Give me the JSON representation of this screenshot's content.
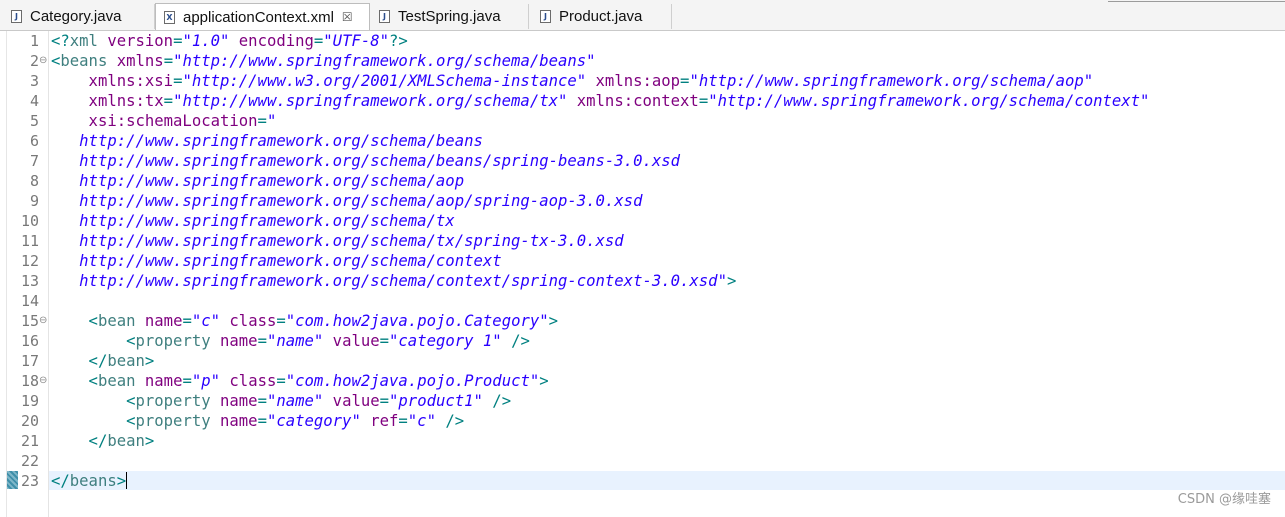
{
  "tabs": [
    {
      "label": "Category.java",
      "icon": "java-file-icon",
      "active": false
    },
    {
      "label": "applicationContext.xml",
      "icon": "xml-file-icon",
      "active": true
    },
    {
      "label": "TestSpring.java",
      "icon": "java-file-icon",
      "active": false
    },
    {
      "label": "Product.java",
      "icon": "java-file-icon",
      "active": false
    }
  ],
  "tab_close_glyph": "☒",
  "editor": {
    "current_line": 23,
    "lines": [
      {
        "n": "1",
        "fold": "",
        "tokens": [
          [
            "b",
            "<?"
          ],
          [
            "t",
            "xml"
          ],
          [
            "a",
            " version"
          ],
          [
            "b",
            "="
          ],
          [
            "v",
            "\"1.0\""
          ],
          [
            "a",
            " encoding"
          ],
          [
            "b",
            "="
          ],
          [
            "v",
            "\"UTF-8\""
          ],
          [
            "b",
            "?>"
          ]
        ]
      },
      {
        "n": "2",
        "fold": "⊖",
        "tokens": [
          [
            "b",
            "<"
          ],
          [
            "t",
            "beans"
          ],
          [
            "a",
            " xmlns"
          ],
          [
            "b",
            "="
          ],
          [
            "v",
            "\"http://www.springframework.org/schema/beans\""
          ]
        ]
      },
      {
        "n": "3",
        "fold": "",
        "tokens": [
          [
            "a",
            "    xmlns:xsi"
          ],
          [
            "b",
            "="
          ],
          [
            "v",
            "\"http://www.w3.org/2001/XMLSchema-instance\""
          ],
          [
            "a",
            " xmlns:aop"
          ],
          [
            "b",
            "="
          ],
          [
            "v",
            "\"http://www.springframework.org/schema/aop\""
          ]
        ]
      },
      {
        "n": "4",
        "fold": "",
        "tokens": [
          [
            "a",
            "    xmlns:tx"
          ],
          [
            "b",
            "="
          ],
          [
            "v",
            "\"http://www.springframework.org/schema/tx\""
          ],
          [
            "a",
            " xmlns:context"
          ],
          [
            "b",
            "="
          ],
          [
            "v",
            "\"http://www.springframework.org/schema/context\""
          ]
        ]
      },
      {
        "n": "5",
        "fold": "",
        "tokens": [
          [
            "a",
            "    xsi:schemaLocation"
          ],
          [
            "b",
            "="
          ],
          [
            "v",
            "\""
          ]
        ]
      },
      {
        "n": "6",
        "fold": "",
        "tokens": [
          [
            "v",
            "   http://www.springframework.org/schema/beans"
          ]
        ]
      },
      {
        "n": "7",
        "fold": "",
        "tokens": [
          [
            "v",
            "   http://www.springframework.org/schema/beans/spring-beans-3.0.xsd"
          ]
        ]
      },
      {
        "n": "8",
        "fold": "",
        "tokens": [
          [
            "v",
            "   http://www.springframework.org/schema/aop"
          ]
        ]
      },
      {
        "n": "9",
        "fold": "",
        "tokens": [
          [
            "v",
            "   http://www.springframework.org/schema/aop/spring-aop-3.0.xsd"
          ]
        ]
      },
      {
        "n": "10",
        "fold": "",
        "tokens": [
          [
            "v",
            "   http://www.springframework.org/schema/tx"
          ]
        ]
      },
      {
        "n": "11",
        "fold": "",
        "tokens": [
          [
            "v",
            "   http://www.springframework.org/schema/tx/spring-tx-3.0.xsd"
          ]
        ]
      },
      {
        "n": "12",
        "fold": "",
        "tokens": [
          [
            "v",
            "   http://www.springframework.org/schema/context"
          ]
        ]
      },
      {
        "n": "13",
        "fold": "",
        "tokens": [
          [
            "v",
            "   http://www.springframework.org/schema/context/spring-context-3.0.xsd\""
          ],
          [
            "b",
            ">"
          ]
        ]
      },
      {
        "n": "14",
        "fold": "",
        "tokens": []
      },
      {
        "n": "15",
        "fold": "⊖",
        "tokens": [
          [
            "b",
            "    <"
          ],
          [
            "t",
            "bean"
          ],
          [
            "a",
            " name"
          ],
          [
            "b",
            "="
          ],
          [
            "v",
            "\"c\""
          ],
          [
            "a",
            " class"
          ],
          [
            "b",
            "="
          ],
          [
            "v",
            "\"com.how2java.pojo.Category\""
          ],
          [
            "b",
            ">"
          ]
        ]
      },
      {
        "n": "16",
        "fold": "",
        "tokens": [
          [
            "b",
            "        <"
          ],
          [
            "t",
            "property"
          ],
          [
            "a",
            " name"
          ],
          [
            "b",
            "="
          ],
          [
            "v",
            "\"name\""
          ],
          [
            "a",
            " value"
          ],
          [
            "b",
            "="
          ],
          [
            "v",
            "\"category 1\""
          ],
          [
            "b",
            " />"
          ]
        ]
      },
      {
        "n": "17",
        "fold": "",
        "tokens": [
          [
            "b",
            "    </"
          ],
          [
            "t",
            "bean"
          ],
          [
            "b",
            ">"
          ]
        ]
      },
      {
        "n": "18",
        "fold": "⊖",
        "tokens": [
          [
            "b",
            "    <"
          ],
          [
            "t",
            "bean"
          ],
          [
            "a",
            " name"
          ],
          [
            "b",
            "="
          ],
          [
            "v",
            "\"p\""
          ],
          [
            "a",
            " class"
          ],
          [
            "b",
            "="
          ],
          [
            "v",
            "\"com.how2java.pojo.Product\""
          ],
          [
            "b",
            ">"
          ]
        ]
      },
      {
        "n": "19",
        "fold": "",
        "tokens": [
          [
            "b",
            "        <"
          ],
          [
            "t",
            "property"
          ],
          [
            "a",
            " name"
          ],
          [
            "b",
            "="
          ],
          [
            "v",
            "\"name\""
          ],
          [
            "a",
            " value"
          ],
          [
            "b",
            "="
          ],
          [
            "v",
            "\"product1\""
          ],
          [
            "b",
            " />"
          ]
        ]
      },
      {
        "n": "20",
        "fold": "",
        "tokens": [
          [
            "b",
            "        <"
          ],
          [
            "t",
            "property"
          ],
          [
            "a",
            " name"
          ],
          [
            "b",
            "="
          ],
          [
            "v",
            "\"category\""
          ],
          [
            "a",
            " ref"
          ],
          [
            "b",
            "="
          ],
          [
            "v",
            "\"c\""
          ],
          [
            "b",
            " />"
          ]
        ]
      },
      {
        "n": "21",
        "fold": "",
        "tokens": [
          [
            "b",
            "    </"
          ],
          [
            "t",
            "bean"
          ],
          [
            "b",
            ">"
          ]
        ]
      },
      {
        "n": "22",
        "fold": "",
        "tokens": []
      },
      {
        "n": "23",
        "fold": "",
        "tokens": [
          [
            "b",
            "</"
          ],
          [
            "t",
            "beans"
          ],
          [
            "b",
            ">"
          ]
        ]
      }
    ]
  },
  "watermark": "CSDN @缘哇塞",
  "colors": {
    "bracket": "#008080",
    "tag": "#3f7f7f",
    "attribute": "#7f007f",
    "value": "#2a00ff",
    "current_line_bg": "#e8f2fe"
  }
}
